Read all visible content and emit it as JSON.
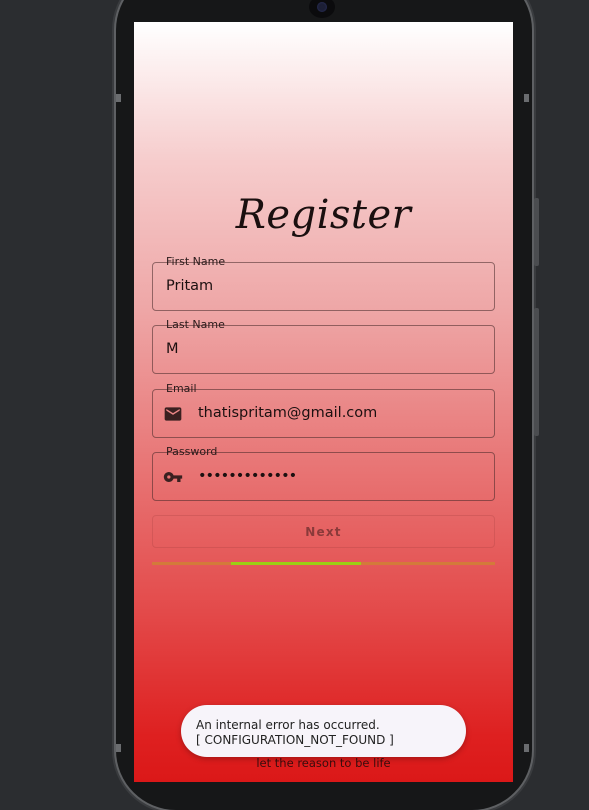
{
  "page": {
    "title": "Register",
    "footer": "let the reason to be life"
  },
  "form": {
    "first_name": {
      "label": "First Name",
      "value": "Pritam"
    },
    "last_name": {
      "label": "Last Name",
      "value": "M"
    },
    "email": {
      "label": "Email",
      "value": "thatispritam@gmail.com",
      "icon": "mail-icon"
    },
    "password": {
      "label": "Password",
      "value": "•••••••••••••",
      "icon": "key-icon"
    },
    "next_label": "Next"
  },
  "progress": {
    "start_fraction": 0.23,
    "end_fraction": 0.61
  },
  "snackbar": {
    "line1": "An internal error has occurred.",
    "line2": "[ CONFIGURATION_NOT_FOUND ]"
  },
  "colors": {
    "gradient_top": "#ffffff",
    "gradient_bottom": "#db1818",
    "progress_track": "#d37a3a",
    "progress_fill": "#9ccf14"
  }
}
